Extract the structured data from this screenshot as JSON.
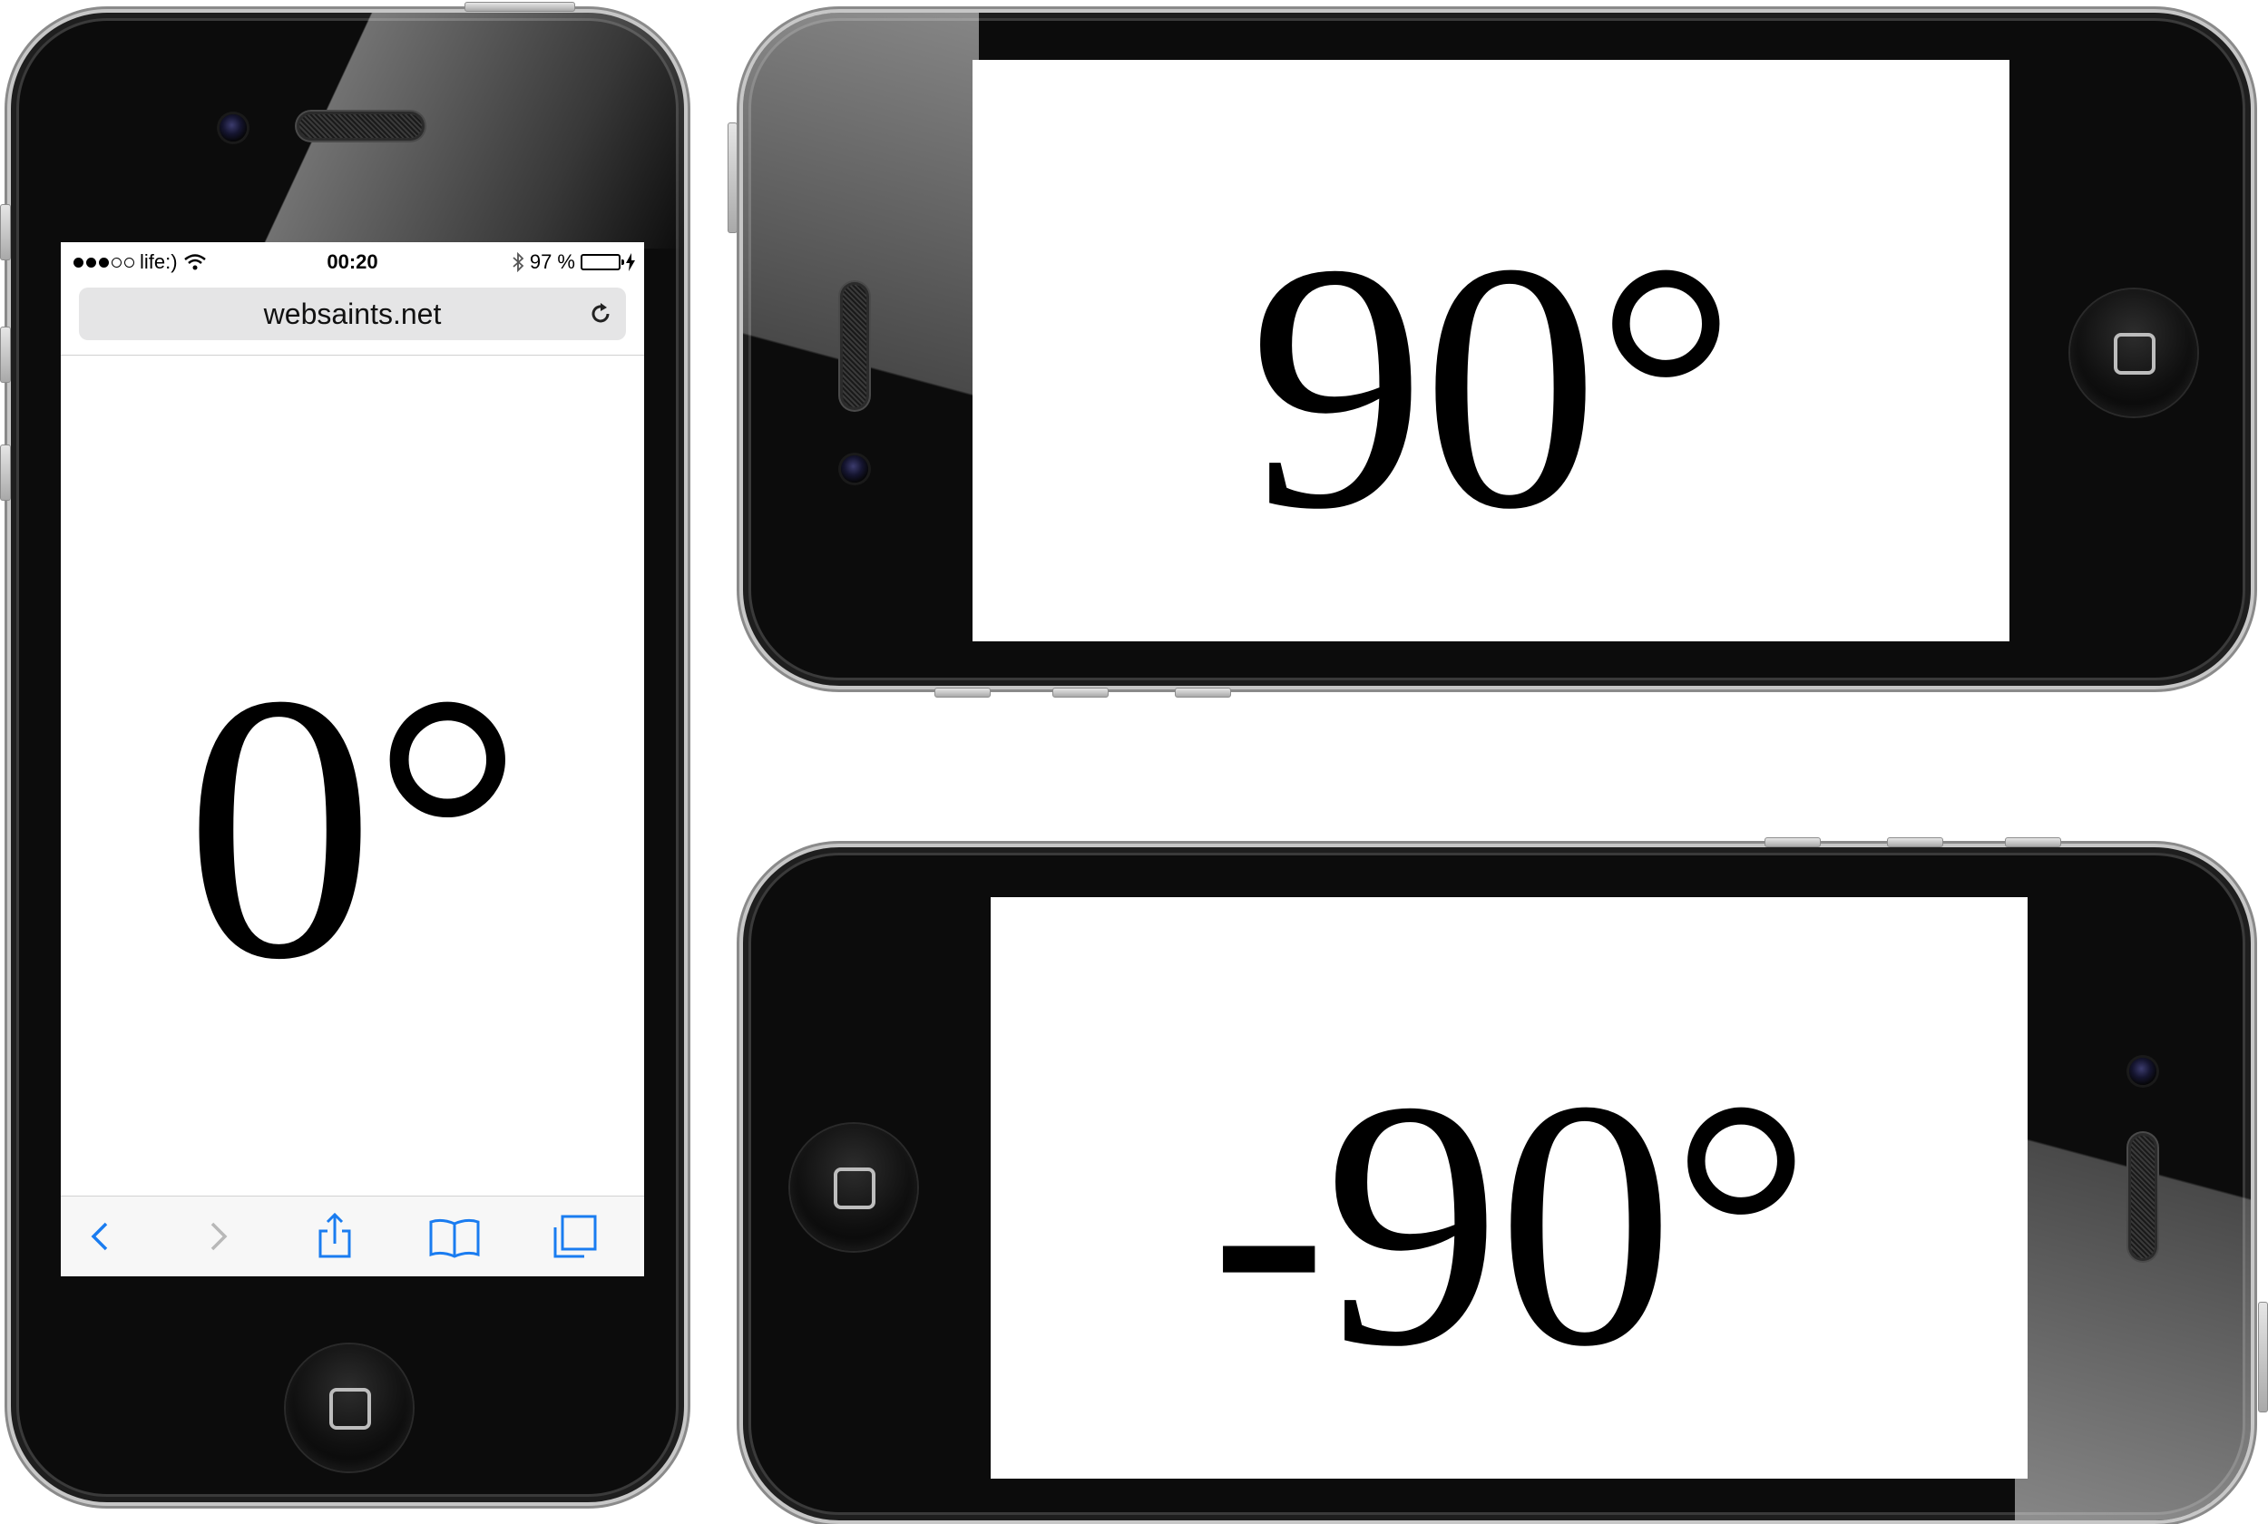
{
  "portrait": {
    "status_bar": {
      "carrier": "life:)",
      "time": "00:20",
      "battery": "97 %",
      "battery_level": 0.97
    },
    "url": "websaints.net",
    "angle": "0°",
    "toolbar_icons": [
      "back-icon",
      "forward-icon",
      "share-icon",
      "bookmarks-icon",
      "tabs-icon"
    ]
  },
  "landscape_left": {
    "angle": "90°"
  },
  "landscape_right": {
    "angle": "-90°"
  },
  "colors": {
    "accent": "#1a7cf0",
    "battery": "#4cd964",
    "body": "#0c0c0c"
  }
}
